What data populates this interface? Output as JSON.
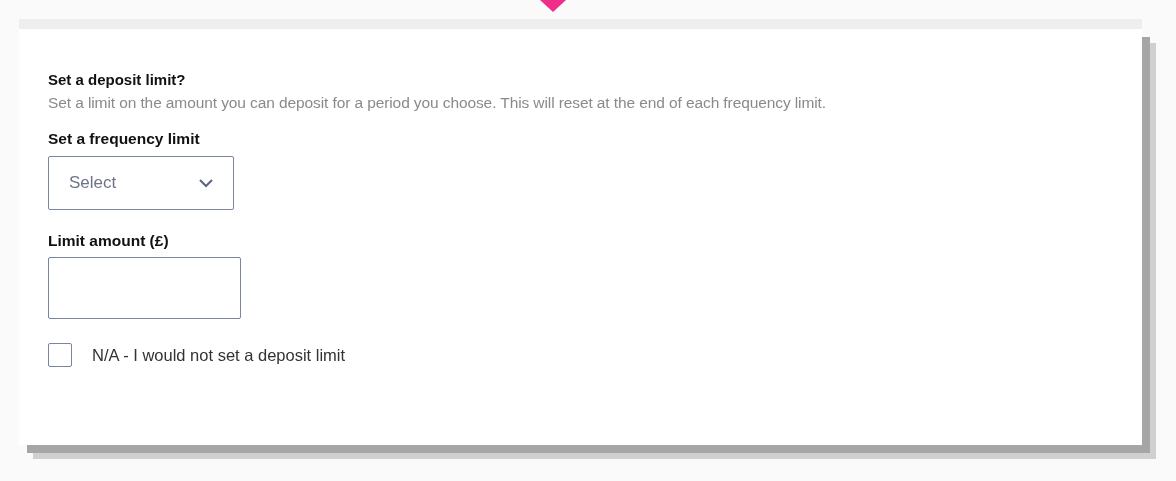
{
  "title": "Set a deposit limit?",
  "description": "Set a limit on the amount you can deposit for a period you choose. This will reset at the end of each frequency limit.",
  "frequency": {
    "label": "Set a frequency limit",
    "placeholder": "Select"
  },
  "amount": {
    "label": "Limit amount (£)"
  },
  "opt_out": {
    "label": "N/A - I would not set a deposit limit",
    "checked": false
  }
}
